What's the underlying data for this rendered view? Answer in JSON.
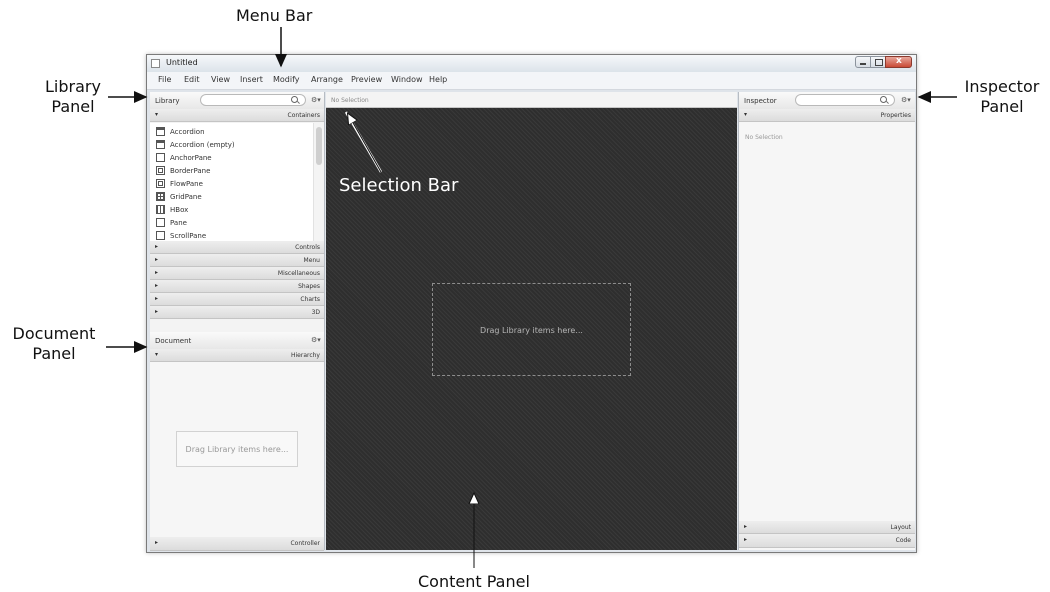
{
  "callouts": {
    "menu_bar": "Menu Bar",
    "library_panel": [
      "Library",
      "Panel"
    ],
    "document_panel": [
      "Document",
      "Panel"
    ],
    "inspector_panel": [
      "Inspector",
      "Panel"
    ],
    "selection_bar": "Selection Bar",
    "content_panel": "Content Panel"
  },
  "window": {
    "title": "Untitled",
    "menu": [
      "File",
      "Edit",
      "View",
      "Insert",
      "Modify",
      "Arrange",
      "Preview",
      "Window",
      "Help"
    ]
  },
  "library": {
    "title": "Library",
    "gear": "⚙▾",
    "open_section": "Containers",
    "items": [
      "Accordion",
      "Accordion  (empty)",
      "AnchorPane",
      "BorderPane",
      "FlowPane",
      "GridPane",
      "HBox",
      "Pane",
      "ScrollPane"
    ],
    "collapsed_sections": [
      "Controls",
      "Menu",
      "Miscellaneous",
      "Shapes",
      "Charts",
      "3D"
    ]
  },
  "document": {
    "title": "Document",
    "gear": "⚙▾",
    "open_section": "Hierarchy",
    "drop_hint": "Drag Library items here...",
    "bottom_section": "Controller"
  },
  "selection_bar": {
    "text": "No Selection"
  },
  "content": {
    "drop_hint": "Drag Library items here..."
  },
  "inspector": {
    "title": "Inspector",
    "gear": "⚙▾",
    "open_section": "Properties",
    "no_selection": "No Selection",
    "bottom_sections": [
      "Layout",
      "Code"
    ]
  },
  "icons": {
    "expanded": "▾",
    "collapsed": "▸"
  }
}
